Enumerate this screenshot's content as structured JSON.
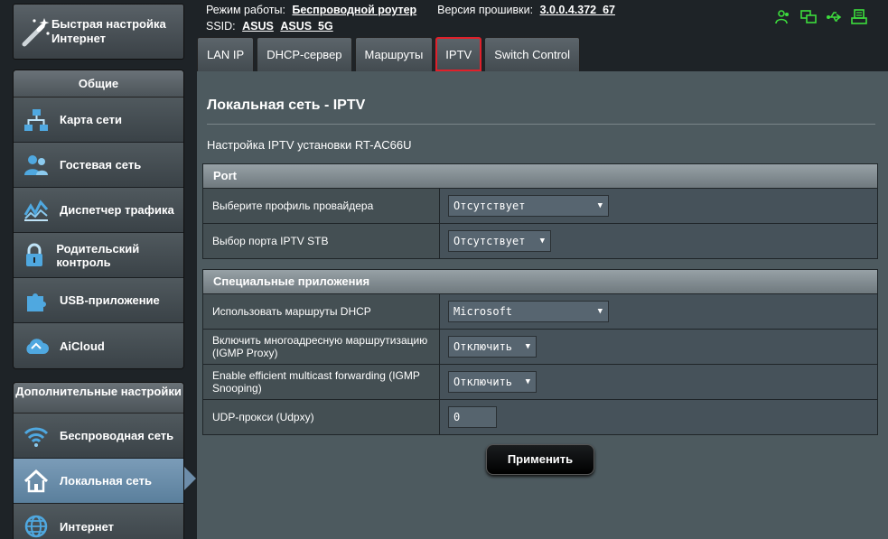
{
  "sidebar": {
    "quick_setup_label": "Быстрая настройка Интернет",
    "group_general": "Общие",
    "general_items": [
      {
        "label": "Карта сети"
      },
      {
        "label": "Гостевая сеть"
      },
      {
        "label": "Диспетчер трафика"
      },
      {
        "label": "Родительский контроль"
      },
      {
        "label": "USB-приложение"
      },
      {
        "label": "AiCloud"
      }
    ],
    "group_advanced": "Дополнительные настройки",
    "advanced_items": [
      {
        "label": "Беспроводная сеть"
      },
      {
        "label": "Локальная сеть"
      },
      {
        "label": "Интернет"
      }
    ]
  },
  "status": {
    "mode_label": "Режим работы:",
    "mode_value": "Беспроводной роутер",
    "firmware_label": "Версия прошивки:",
    "firmware_value": "3.0.0.4.372_67",
    "ssid_label": "SSID:",
    "ssid_1": "ASUS",
    "ssid_2": "ASUS_5G"
  },
  "tabs": [
    {
      "label": "LAN IP"
    },
    {
      "label": "DHCP-сервер"
    },
    {
      "label": "Маршруты"
    },
    {
      "label": "IPTV"
    },
    {
      "label": "Switch Control"
    }
  ],
  "page": {
    "title": "Локальная сеть - IPTV",
    "subtitle": "Настройка IPTV установки RT-AC66U"
  },
  "port_section": {
    "heading": "Port",
    "rows": [
      {
        "label": "Выберите профиль провайдера",
        "value": "Отсутствует"
      },
      {
        "label": "Выбор порта IPTV STB",
        "value": "Отсутствует"
      }
    ]
  },
  "special_section": {
    "heading": "Специальные приложения",
    "rows": [
      {
        "label": "Использовать маршруты DHCP",
        "value": "Microsoft"
      },
      {
        "label": "Включить многоадресную маршрутизацию (IGMP Proxy)",
        "value": "Отключить"
      },
      {
        "label": "Enable efficient multicast forwarding (IGMP Snooping)",
        "value": "Отключить"
      },
      {
        "label": "UDP-прокси (Udpxy)",
        "value": "0"
      }
    ]
  },
  "apply_label": "Применить",
  "colors": {
    "accent_green": "#3ddc3d",
    "active_tab_outline": "#e0202a",
    "active_item": "#6d8daa"
  }
}
